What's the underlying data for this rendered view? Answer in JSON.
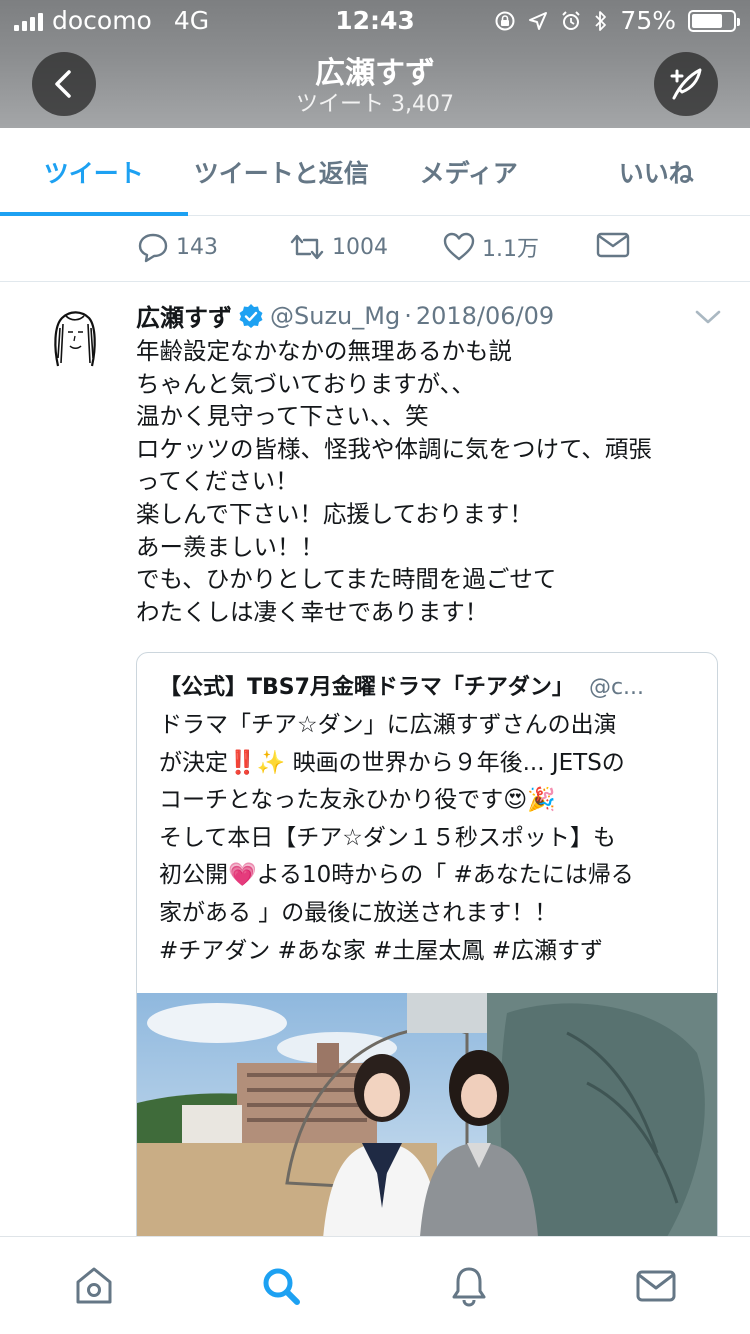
{
  "status_bar": {
    "carrier": "docomo",
    "network": "4G",
    "time": "12:43",
    "battery": "75%",
    "battery_level": 0.75
  },
  "header": {
    "name": "広瀬すず",
    "tweets_label": "ツイート",
    "tweets_count": "3,407"
  },
  "tabs": [
    {
      "label": "ツイート",
      "active": true
    },
    {
      "label": "ツイートと返信",
      "active": false
    },
    {
      "label": "メディア",
      "active": false
    },
    {
      "label": "いいね",
      "active": false
    }
  ],
  "actions": {
    "replies": "143",
    "retweets": "1004",
    "likes": "1.1万"
  },
  "tweet": {
    "author": "広瀬すず",
    "handle": "@Suzu_Mg",
    "separator": "·",
    "date": "2018/06/09",
    "text": "年齢設定なかなかの無理あるかも説\nちゃんと気づいておりますが、、\n温かく見守って下さい、、笑\nロケッツの皆様、怪我や体調に気をつけて、頑張\nってください！\n楽しんで下さい！応援しております！\nあー羨ましい！！\nでも、ひかりとしてまた時間を過ごせて\nわたくしは凄く幸せであります！"
  },
  "quoted": {
    "name": "【公式】TBS7月金曜ドラマ「チアダン」",
    "handle": "@c...",
    "text": "ドラマ「チア☆ダン」に広瀬すずさんの出演\nが決定‼️✨ 映画の世界から９年後... JETSの\nコーチとなった友永ひかり役です😍🎉\nそして本日【チア☆ダン１５秒スポット】も\n初公開💗よる10時からの「 #あなたには帰る\n家がある 」の最後に放送されます！！\n#チアダン #あな家 #土屋太鳳 #広瀬すず"
  },
  "colors": {
    "accent": "#1da1f2",
    "muted": "#657786",
    "text": "#14171a",
    "border": "#e1e8ed"
  },
  "icons": {
    "bottom_bar": [
      "home-icon",
      "search-icon",
      "notifications-icon",
      "messages-icon"
    ],
    "active_bottom": "search-icon"
  }
}
